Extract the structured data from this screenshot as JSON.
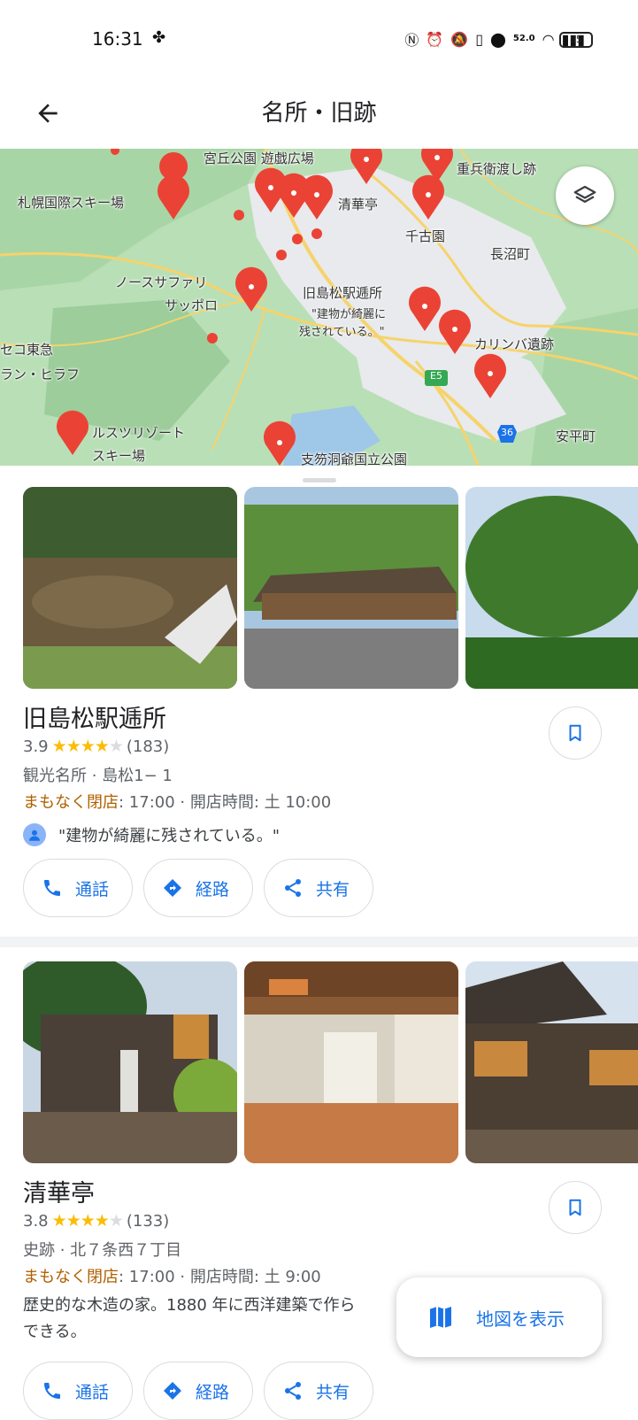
{
  "status_bar": {
    "time": "16:31",
    "speed": "52.0",
    "battery": "85"
  },
  "header": {
    "title": "名所・旧跡"
  },
  "map": {
    "labels": {
      "miyagaoka": "宮丘公園 遊戯広場",
      "sapporo_kokusai": "札幌国際スキー場",
      "seikatei": "清華亭",
      "chikoen": "千古園",
      "naganuma": "長沼町",
      "north_safari": "ノースサファリ",
      "sapporo": "サッポロ",
      "shimamatsu": "旧島松駅逓所",
      "review_1": "\"建物が綺麗に",
      "review_2": "残されている。\"",
      "karinba": "カリンバ遺跡",
      "niseko_1": "セコ東急",
      "niseko_2": "ラン・ヒラフ",
      "rusutsu_1": "ルスツリゾート",
      "rusutsu_2": "スキー場",
      "shikotsu": "支笏洞爺国立公園",
      "juhei": "重兵衛渡し跡",
      "e5": "E5",
      "route36": "36",
      "abira": "安平町"
    }
  },
  "places": [
    {
      "name": "旧島松駅逓所",
      "rating": "3.9",
      "stars": 4,
      "reviews_count": "(183)",
      "category_address": "観光名所 · 島松1− 1",
      "status": "まもなく閉店",
      "hours": ": 17:00 · 開店時間: 土 10:00",
      "review": "\"建物が綺麗に残されている。\"",
      "actions": {
        "call": "通話",
        "directions": "経路",
        "share": "共有"
      }
    },
    {
      "name": "清華亭",
      "rating": "3.8",
      "stars": 4,
      "reviews_count": "(133)",
      "category_address": "史跡 · 北７条西７丁目",
      "status": "まもなく閉店",
      "hours": ": 17:00 · 開店時間: 土 9:00",
      "description": "歴史的な木造の家。1880 年に西洋建築で作ら",
      "description_2": "できる。",
      "actions": {
        "call": "通話",
        "directions": "経路",
        "share": "共有"
      }
    }
  ],
  "fab": {
    "label": "地図を表示"
  },
  "colors": {
    "accent": "#1a73e8",
    "pin": "#ea4335",
    "closing": "#b06000",
    "star": "#fbbc04"
  }
}
